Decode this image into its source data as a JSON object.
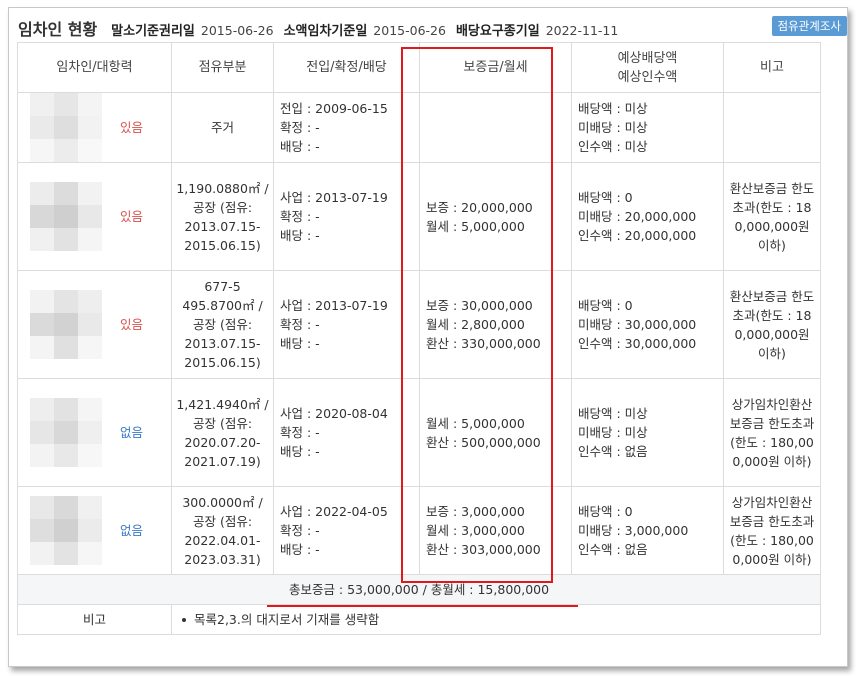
{
  "header": {
    "title": "임차인 현황",
    "base_right_label": "말소기준권리일",
    "base_right_date": "2015-06-26",
    "small_lease_label": "소액임차기준일",
    "small_lease_date": "2015-06-26",
    "dividend_label": "배당요구종기일",
    "dividend_date": "2022-11-11",
    "report_button": "점유관계조사"
  },
  "columns": {
    "tenant": "임차인/대항력",
    "part": "점유부분",
    "move": "전입/확정/배당",
    "deposit": "보증금/월세",
    "expected_line1": "예상배당액",
    "expected_line2": "예상인수액",
    "etc": "비고"
  },
  "rows": [
    {
      "opposing": "있음",
      "part": "주거",
      "move": [
        "전입 : 2009-06-15",
        "확정 : -",
        "배당 : -"
      ],
      "deposit": [],
      "expected": [
        "배당액 : 미상",
        "미배당 : 미상",
        "인수액 : 미상"
      ],
      "etc": ""
    },
    {
      "opposing": "있음",
      "part": "1,190.0880㎡ / 공장 (점유: 2013.07.15-2015.06.15)",
      "move": [
        "사업 : 2013-07-19",
        "확정 : -",
        "배당 : -"
      ],
      "deposit": [
        "보증 : 20,000,000",
        "월세 : 5,000,000"
      ],
      "expected": [
        "배당액 : 0",
        "미배당 : 20,000,000",
        "인수액 : 20,000,000"
      ],
      "etc": "환산보증금 한도초과(한도 : 180,000,000원 이하)"
    },
    {
      "opposing": "있음",
      "part": "677-5 495.8700㎡ / 공장 (점유: 2013.07.15-2015.06.15)",
      "move": [
        "사업 : 2013-07-19",
        "확정 : -",
        "배당 : -"
      ],
      "deposit": [
        "보증 : 30,000,000",
        "월세 : 2,800,000",
        "환산 : 330,000,000"
      ],
      "expected": [
        "배당액 : 0",
        "미배당 : 30,000,000",
        "인수액 : 30,000,000"
      ],
      "etc": "환산보증금 한도초과(한도 : 180,000,000원 이하)"
    },
    {
      "opposing": "없음",
      "part": "1,421.4940㎡ / 공장 (점유: 2020.07.20-2021.07.19)",
      "move": [
        "사업 : 2020-08-04",
        "확정 : -",
        "배당 : -"
      ],
      "deposit": [
        "월세 : 5,000,000",
        "환산 : 500,000,000"
      ],
      "expected": [
        "배당액 : 미상",
        "미배당 : 미상",
        "인수액 : 없음"
      ],
      "etc": "상가임차인환산보증금 한도초과(한도 : 180,000,000원 이하)"
    },
    {
      "opposing": "없음",
      "part": "300.0000㎡ / 공장 (점유: 2022.04.01-2023.03.31)",
      "move": [
        "사업 : 2022-04-05",
        "확정 : -",
        "배당 : -"
      ],
      "deposit": [
        "보증 : 3,000,000",
        "월세 : 3,000,000",
        "환산 : 303,000,000"
      ],
      "expected": [
        "배당액 : 0",
        "미배당 : 3,000,000",
        "인수액 : 없음"
      ],
      "etc": "상가임차인환산보증금 한도초과(한도 : 180,000,000원 이하)"
    }
  ],
  "total": "총보증금 : 53,000,000  /  총월세 : 15,800,000",
  "note": {
    "label": "비고",
    "text": "목록2,3.의 대지로서 기재를 생략함"
  },
  "colors": {
    "highlight": "#e0191d",
    "opposing_yes": "#d9534f",
    "opposing_no": "#3a7bc8",
    "button": "#5b9bd5"
  }
}
